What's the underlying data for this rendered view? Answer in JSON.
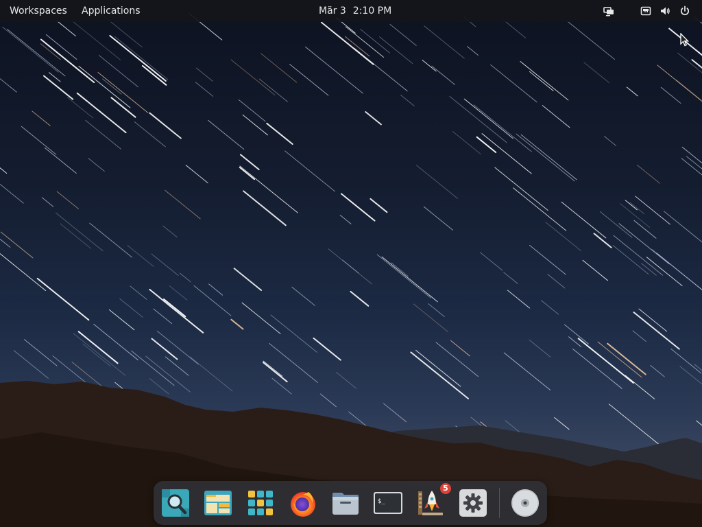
{
  "top_panel": {
    "workspaces_label": "Workspaces",
    "applications_label": "Applications",
    "clock": {
      "date": "Mär 3",
      "time": "2:10 PM"
    },
    "tray_icons": [
      "display-icon",
      "network-icon",
      "volume-icon",
      "power-icon"
    ]
  },
  "dock": {
    "items": [
      {
        "name": "search-app",
        "icon": "magnifier-icon"
      },
      {
        "name": "file-manager-app",
        "icon": "window-layout-icon"
      },
      {
        "name": "app-grid",
        "icon": "grid-icon"
      },
      {
        "name": "firefox-app",
        "icon": "firefox-icon"
      },
      {
        "name": "files-app",
        "icon": "folder-icon"
      },
      {
        "name": "terminal-app",
        "icon": "terminal-icon"
      },
      {
        "name": "software-center-app",
        "icon": "rocket-icon",
        "badge": "5"
      },
      {
        "name": "settings-app",
        "icon": "gear-icon"
      },
      {
        "name": "disk-app",
        "icon": "disc-icon"
      }
    ],
    "terminal_prompt": "$_"
  },
  "colors": {
    "panel_bg": "#14161a",
    "badge": "#d9453a",
    "sky_top": "#0d1220",
    "sky_bottom": "#3a4660",
    "mountains": "#2a1d17"
  }
}
